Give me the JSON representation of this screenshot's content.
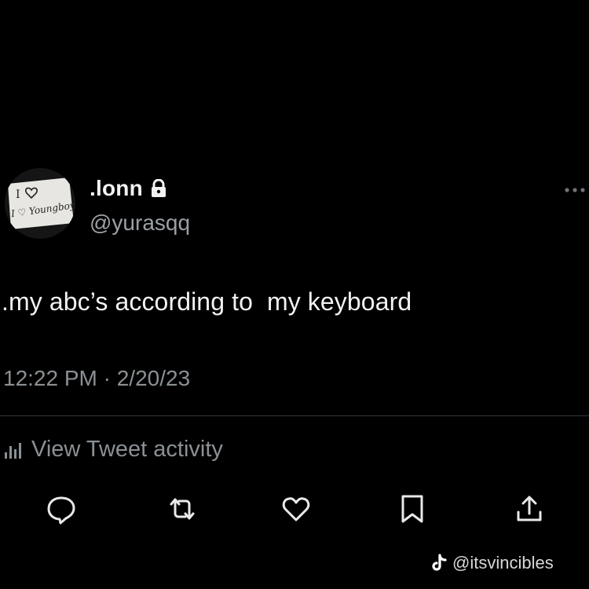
{
  "tweet": {
    "display_name": ".lonn",
    "handle": "@yurasqq",
    "text": ".my abc’s according to  my keyboard",
    "timestamp": "12:22 PM · 2/20/23",
    "activity_label": "View Tweet activity",
    "avatar_text": "I ♡ Youngboy"
  },
  "icons": {
    "lock": "lock-icon",
    "more": "more-options-icon",
    "activity": "bar-chart-icon",
    "reply": "speech-bubble-icon",
    "retweet": "retweet-icon",
    "like": "heart-icon",
    "bookmark": "bookmark-icon",
    "share": "share-upload-icon"
  },
  "watermark": {
    "platform_icon": "tiktok-icon",
    "text": "@itsvincibles"
  },
  "colors": {
    "background": "#000000",
    "primary_text": "#f2f2f2",
    "secondary_text": "#8b9094",
    "divider": "#333638"
  }
}
